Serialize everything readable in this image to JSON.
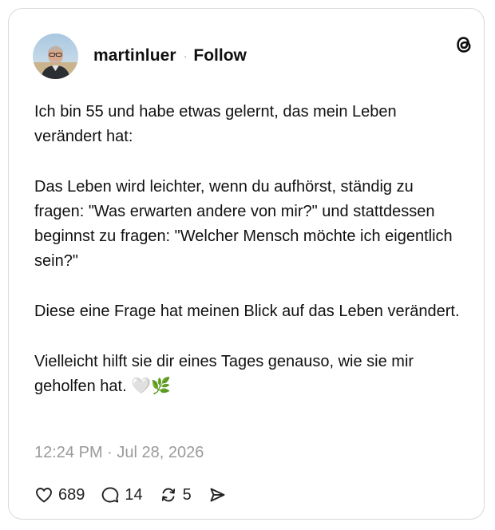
{
  "post": {
    "username": "martinluer",
    "separator": "·",
    "follow_label": "Follow",
    "paragraphs": [
      "Ich bin 55 und habe etwas gelernt, das mein Leben verändert hat:",
      "Das Leben wird leichter, wenn du aufhörst, ständig zu fragen: \"Was erwarten andere von mir?\" und stattdessen beginnst zu fragen: \"Welcher Mensch möchte ich eigentlich sein?\"",
      "Diese eine Frage hat meinen Blick auf das Leben verändert.",
      "Vielleicht hilft sie dir eines Tages genauso, wie sie mir geholfen hat. 🤍🌿"
    ],
    "timestamp": "12:24 PM · Jul 28, 2026"
  },
  "actions": {
    "likes": "689",
    "replies": "14",
    "reposts": "5"
  },
  "icons": {
    "brand": "threads-logo-icon",
    "like": "heart-icon",
    "reply": "comment-bubble-icon",
    "repost": "repost-icon",
    "share": "send-icon"
  },
  "colors": {
    "text": "#101010",
    "muted": "#9a9a9a",
    "border": "#d9d9d9"
  }
}
